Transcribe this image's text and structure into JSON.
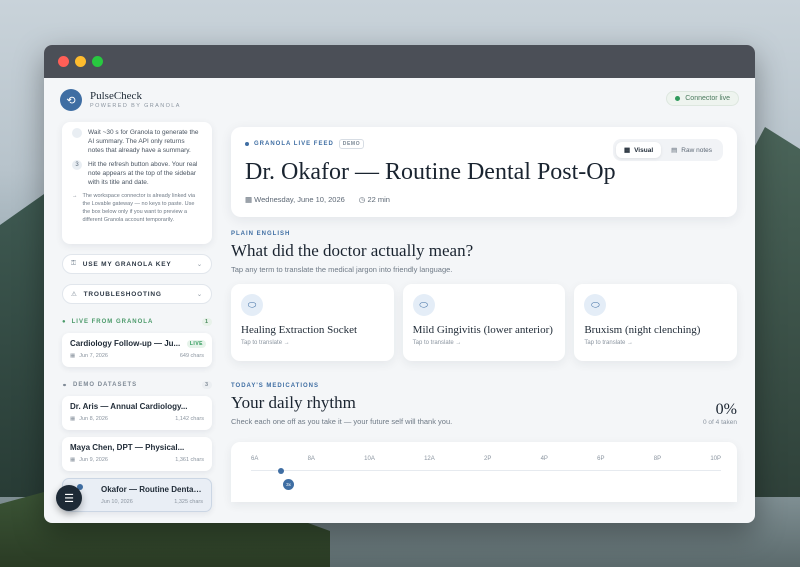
{
  "app": {
    "name": "PulseCheck",
    "subtitle": "POWERED BY GRANOLA",
    "connector": "Connector live"
  },
  "sidebar": {
    "steps": [
      {
        "num": "",
        "text": "Wait ~30 s for Granola to generate the AI summary. The API only returns notes that already have a summary."
      },
      {
        "num": "3",
        "text": "Hit the refresh button above. Your real note appears at the top of the sidebar with its title and date."
      }
    ],
    "workspace_note": "The workspace connector is already linked via the Lovable gateway — no keys to paste. Use the box below only if you want to preview a different Granola account temporarily.",
    "use_key": "USE MY GRANOLA KEY",
    "troubleshooting": "TROUBLESHOOTING",
    "live_label": "LIVE FROM GRANOLA",
    "live_count": "1",
    "live_notes": [
      {
        "title": "Cardiology Follow-up — Ju...",
        "date": "Jun 7, 2026",
        "chars": "649 chars",
        "badge": "LIVE"
      }
    ],
    "demo_label": "DEMO DATASETS",
    "demo_count": "3",
    "demo_notes": [
      {
        "title": "Dr. Aris — Annual Cardiology...",
        "date": "Jun 8, 2026",
        "chars": "1,142 chars"
      },
      {
        "title": "Maya Chen, DPT — Physical...",
        "date": "Jun 9, 2026",
        "chars": "1,361 chars"
      },
      {
        "title": "Okafor — Routine Dental Post...",
        "date": "Jun 10, 2026",
        "chars": "1,325 chars"
      }
    ]
  },
  "header": {
    "feed": "GRANOLA LIVE FEED",
    "demo": "DEMO",
    "title": "Dr. Okafor — Routine Dental Post-Op",
    "date": "Wednesday, June 10, 2026",
    "duration": "22 min",
    "toggle_visual": "Visual",
    "toggle_raw": "Raw notes"
  },
  "plain": {
    "kicker": "PLAIN ENGLISH",
    "title": "What did the doctor actually mean?",
    "sub": "Tap any term to translate the medical jargon into friendly language.",
    "terms": [
      {
        "name": "Healing Extraction Socket",
        "tap": "Tap to translate →"
      },
      {
        "name": "Mild Gingivitis (lower anterior)",
        "tap": "Tap to translate →"
      },
      {
        "name": "Bruxism (night clenching)",
        "tap": "Tap to translate →"
      }
    ]
  },
  "meds": {
    "kicker": "TODAY'S MEDICATIONS",
    "title": "Your daily rhythm",
    "sub": "Check each one off as you take it — your future self will thank you.",
    "percent": "0%",
    "taken": "0 of 4 taken",
    "hours": [
      "6A",
      "8A",
      "10A",
      "12A",
      "2P",
      "4P",
      "6P",
      "8P",
      "10P"
    ],
    "chip": "3x"
  },
  "colors": {
    "accent": "#3f6ea3",
    "live": "#2f9a5b"
  }
}
